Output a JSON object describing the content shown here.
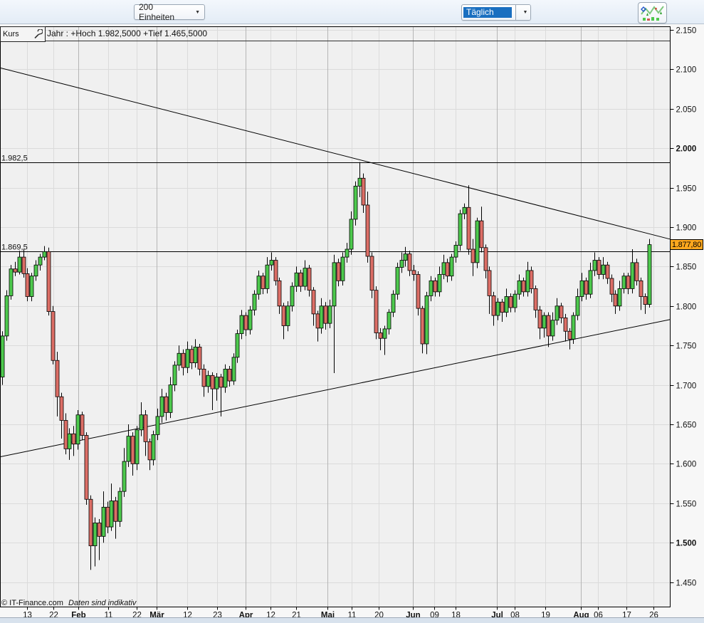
{
  "toolbar": {
    "units_label": "200 Einheiten",
    "period_value": "Täglich",
    "chart_type_icon": "candlestick-chart-icon"
  },
  "chart_header": {
    "kurs_label": "Kurs",
    "wrench_icon": "wrench-icon",
    "info_text": "Jahr : +Hoch 1.982,5000 +Tief 1.465,5000"
  },
  "price_badge": {
    "label": "1.877,80",
    "value": 1877.8,
    "color": "#ffa81e"
  },
  "footer": {
    "copyright": "© IT-Finance.com",
    "disclaimer": "Daten sind indikativ"
  },
  "colors": {
    "up": "#4dc94d",
    "down": "#dc6e66",
    "candle_border": "#000000",
    "grid": "#dbdbdb",
    "month_grid": "#b5b5b5",
    "plot_bg": "#f0f0f0",
    "axis_bg": "#f7f7f7",
    "badge": "#ffa81e",
    "period_selected_bg": "#1a6fc0"
  },
  "chart_data": {
    "type": "candlestick",
    "period": "Täglich",
    "title": "Kurs",
    "ylim": [
      1419,
      2154
    ],
    "grid": true,
    "y_ticks": [
      {
        "label": "2.150",
        "value": 2150,
        "bold": false
      },
      {
        "label": "2.100",
        "value": 2100,
        "bold": false
      },
      {
        "label": "2.050",
        "value": 2050,
        "bold": false
      },
      {
        "label": "2.000",
        "value": 2000,
        "bold": true
      },
      {
        "label": "1.950",
        "value": 1950,
        "bold": false
      },
      {
        "label": "1.900",
        "value": 1900,
        "bold": false
      },
      {
        "label": "1.850",
        "value": 1850,
        "bold": false
      },
      {
        "label": "1.800",
        "value": 1800,
        "bold": false
      },
      {
        "label": "1.750",
        "value": 1750,
        "bold": false
      },
      {
        "label": "1.700",
        "value": 1700,
        "bold": false
      },
      {
        "label": "1.650",
        "value": 1650,
        "bold": false
      },
      {
        "label": "1.600",
        "value": 1600,
        "bold": false
      },
      {
        "label": "1.550",
        "value": 1550,
        "bold": false
      },
      {
        "label": "1.500",
        "value": 1500,
        "bold": true
      },
      {
        "label": "1.450",
        "value": 1450,
        "bold": false
      }
    ],
    "x_ticks": [
      {
        "label": "13",
        "x": 38,
        "bold": false,
        "month": false
      },
      {
        "label": "22",
        "x": 75,
        "bold": false,
        "month": false
      },
      {
        "label": "Feb",
        "x": 110,
        "bold": true,
        "month": true
      },
      {
        "label": "11",
        "x": 152,
        "bold": false,
        "month": false
      },
      {
        "label": "22",
        "x": 192,
        "bold": false,
        "month": false
      },
      {
        "label": "Mär",
        "x": 220,
        "bold": true,
        "month": true
      },
      {
        "label": "12",
        "x": 263,
        "bold": false,
        "month": false
      },
      {
        "label": "23",
        "x": 305,
        "bold": false,
        "month": false
      },
      {
        "label": "Apr",
        "x": 345,
        "bold": true,
        "month": true
      },
      {
        "label": "12",
        "x": 380,
        "bold": false,
        "month": false
      },
      {
        "label": "21",
        "x": 416,
        "bold": false,
        "month": false
      },
      {
        "label": "Mai",
        "x": 460,
        "bold": true,
        "month": true
      },
      {
        "label": "11",
        "x": 494,
        "bold": false,
        "month": false
      },
      {
        "label": "20",
        "x": 532,
        "bold": false,
        "month": false
      },
      {
        "label": "Jun",
        "x": 580,
        "bold": true,
        "month": true
      },
      {
        "label": "09",
        "x": 610,
        "bold": false,
        "month": false
      },
      {
        "label": "18",
        "x": 640,
        "bold": false,
        "month": false
      },
      {
        "label": "Jul",
        "x": 698,
        "bold": true,
        "month": true
      },
      {
        "label": "08",
        "x": 723,
        "bold": false,
        "month": false
      },
      {
        "label": "19",
        "x": 766,
        "bold": false,
        "month": false
      },
      {
        "label": "Aug",
        "x": 816,
        "bold": true,
        "month": true
      },
      {
        "label": "06",
        "x": 840,
        "bold": false,
        "month": false
      },
      {
        "label": "17",
        "x": 880,
        "bold": false,
        "month": false
      },
      {
        "label": "26",
        "x": 918,
        "bold": false,
        "month": false
      }
    ],
    "horizontal_lines": [
      {
        "label": "1.982,5",
        "value": 1982.5
      },
      {
        "label": "1.869,5",
        "value": 1869.5
      }
    ],
    "trendlines": [
      {
        "name": "descending-resistance",
        "v_start": 2102,
        "v_end": 1884.7
      },
      {
        "name": "ascending-support",
        "v_start": 1608.8,
        "v_end": 1782.9
      }
    ],
    "year_high": 1982.5,
    "year_low": 1465.5,
    "last": 1877.8,
    "candles": [
      [
        1710,
        1768,
        1700,
        1762
      ],
      [
        1762,
        1820,
        1756,
        1813
      ],
      [
        1813,
        1852,
        1808,
        1847
      ],
      [
        1847,
        1856,
        1838,
        1843
      ],
      [
        1843,
        1870,
        1840,
        1862
      ],
      [
        1862,
        1872,
        1836,
        1841
      ],
      [
        1841,
        1848,
        1806,
        1812
      ],
      [
        1812,
        1842,
        1806,
        1838
      ],
      [
        1838,
        1858,
        1832,
        1852
      ],
      [
        1852,
        1866,
        1845,
        1862
      ],
      [
        1862,
        1876,
        1858,
        1869
      ],
      [
        1869,
        1874,
        1788,
        1793
      ],
      [
        1793,
        1800,
        1726,
        1731
      ],
      [
        1731,
        1742,
        1660,
        1685
      ],
      [
        1685,
        1690,
        1632,
        1655
      ],
      [
        1655,
        1664,
        1612,
        1619
      ],
      [
        1619,
        1645,
        1605,
        1638
      ],
      [
        1638,
        1648,
        1610,
        1625
      ],
      [
        1625,
        1668,
        1618,
        1662
      ],
      [
        1662,
        1666,
        1630,
        1636
      ],
      [
        1636,
        1640,
        1548,
        1555
      ],
      [
        1555,
        1560,
        1465.5,
        1496
      ],
      [
        1496,
        1532,
        1470,
        1525
      ],
      [
        1525,
        1530,
        1478,
        1508
      ],
      [
        1508,
        1565,
        1500,
        1545
      ],
      [
        1545,
        1552,
        1512,
        1520
      ],
      [
        1520,
        1575,
        1515,
        1553
      ],
      [
        1553,
        1558,
        1505,
        1527
      ],
      [
        1527,
        1570,
        1520,
        1565
      ],
      [
        1565,
        1620,
        1558,
        1603
      ],
      [
        1603,
        1650,
        1596,
        1635
      ],
      [
        1635,
        1640,
        1585,
        1600
      ],
      [
        1600,
        1648,
        1592,
        1643
      ],
      [
        1643,
        1678,
        1635,
        1662
      ],
      [
        1662,
        1668,
        1610,
        1628
      ],
      [
        1628,
        1632,
        1592,
        1605
      ],
      [
        1605,
        1642,
        1598,
        1637
      ],
      [
        1637,
        1670,
        1630,
        1660
      ],
      [
        1660,
        1695,
        1652,
        1685
      ],
      [
        1685,
        1690,
        1655,
        1665
      ],
      [
        1665,
        1710,
        1658,
        1700
      ],
      [
        1700,
        1730,
        1692,
        1725
      ],
      [
        1725,
        1750,
        1718,
        1740
      ],
      [
        1740,
        1745,
        1712,
        1722
      ],
      [
        1722,
        1755,
        1715,
        1745
      ],
      [
        1745,
        1750,
        1720,
        1728
      ],
      [
        1728,
        1758,
        1722,
        1748
      ],
      [
        1748,
        1752,
        1712,
        1720
      ],
      [
        1720,
        1726,
        1685,
        1698
      ],
      [
        1698,
        1718,
        1690,
        1712
      ],
      [
        1712,
        1716,
        1668,
        1695
      ],
      [
        1695,
        1715,
        1680,
        1710
      ],
      [
        1710,
        1714,
        1660,
        1697
      ],
      [
        1697,
        1726,
        1690,
        1720
      ],
      [
        1720,
        1724,
        1698,
        1705
      ],
      [
        1705,
        1740,
        1700,
        1735
      ],
      [
        1735,
        1770,
        1728,
        1765
      ],
      [
        1765,
        1795,
        1758,
        1788
      ],
      [
        1788,
        1792,
        1762,
        1770
      ],
      [
        1770,
        1800,
        1764,
        1795
      ],
      [
        1795,
        1820,
        1788,
        1815
      ],
      [
        1815,
        1845,
        1808,
        1838
      ],
      [
        1838,
        1842,
        1815,
        1822
      ],
      [
        1822,
        1862,
        1816,
        1852
      ],
      [
        1852,
        1868,
        1845,
        1858
      ],
      [
        1858,
        1862,
        1826,
        1832
      ],
      [
        1832,
        1836,
        1790,
        1800
      ],
      [
        1800,
        1804,
        1758,
        1775
      ],
      [
        1775,
        1806,
        1768,
        1800
      ],
      [
        1800,
        1830,
        1793,
        1825
      ],
      [
        1825,
        1850,
        1818,
        1842
      ],
      [
        1842,
        1846,
        1818,
        1825
      ],
      [
        1825,
        1858,
        1820,
        1848
      ],
      [
        1848,
        1852,
        1812,
        1820
      ],
      [
        1820,
        1824,
        1775,
        1790
      ],
      [
        1790,
        1794,
        1755,
        1772
      ],
      [
        1772,
        1810,
        1765,
        1800
      ],
      [
        1800,
        1805,
        1770,
        1778
      ],
      [
        1778,
        1808,
        1772,
        1800
      ],
      [
        1800,
        1865,
        1715,
        1855
      ],
      [
        1855,
        1860,
        1825,
        1832
      ],
      [
        1832,
        1868,
        1826,
        1862
      ],
      [
        1862,
        1880,
        1855,
        1872
      ],
      [
        1872,
        1920,
        1865,
        1910
      ],
      [
        1910,
        1958,
        1902,
        1952
      ],
      [
        1952,
        1982.5,
        1938,
        1962
      ],
      [
        1962,
        1968,
        1918,
        1928
      ],
      [
        1928,
        1945,
        1855,
        1863
      ],
      [
        1863,
        1868,
        1810,
        1820
      ],
      [
        1820,
        1825,
        1758,
        1766
      ],
      [
        1766,
        1772,
        1744,
        1759
      ],
      [
        1759,
        1775,
        1738,
        1771
      ],
      [
        1771,
        1796,
        1764,
        1792
      ],
      [
        1792,
        1820,
        1786,
        1815
      ],
      [
        1815,
        1855,
        1808,
        1849
      ],
      [
        1849,
        1868,
        1842,
        1858
      ],
      [
        1858,
        1875,
        1850,
        1866
      ],
      [
        1866,
        1870,
        1838,
        1845
      ],
      [
        1845,
        1852,
        1832,
        1840
      ],
      [
        1840,
        1844,
        1788,
        1797
      ],
      [
        1797,
        1800,
        1740,
        1752
      ],
      [
        1752,
        1818,
        1739,
        1813
      ],
      [
        1813,
        1838,
        1806,
        1832
      ],
      [
        1832,
        1836,
        1812,
        1818
      ],
      [
        1818,
        1850,
        1812,
        1840
      ],
      [
        1840,
        1865,
        1834,
        1855
      ],
      [
        1855,
        1860,
        1830,
        1838
      ],
      [
        1838,
        1866,
        1832,
        1862
      ],
      [
        1862,
        1882,
        1855,
        1877
      ],
      [
        1877,
        1922,
        1870,
        1917
      ],
      [
        1917,
        1930,
        1910,
        1925
      ],
      [
        1925,
        1953,
        1865,
        1872
      ],
      [
        1872,
        1885,
        1838,
        1855
      ],
      [
        1855,
        1912,
        1848,
        1908
      ],
      [
        1908,
        1926,
        1868,
        1874
      ],
      [
        1874,
        1878,
        1835,
        1845
      ],
      [
        1845,
        1850,
        1790,
        1813
      ],
      [
        1813,
        1818,
        1775,
        1788
      ],
      [
        1788,
        1810,
        1782,
        1805
      ],
      [
        1805,
        1809,
        1780,
        1792
      ],
      [
        1792,
        1822,
        1786,
        1812
      ],
      [
        1812,
        1816,
        1792,
        1798
      ],
      [
        1798,
        1820,
        1792,
        1815
      ],
      [
        1815,
        1840,
        1808,
        1832
      ],
      [
        1832,
        1836,
        1812,
        1818
      ],
      [
        1818,
        1856,
        1812,
        1845
      ],
      [
        1845,
        1850,
        1816,
        1822
      ],
      [
        1822,
        1826,
        1785,
        1795
      ],
      [
        1795,
        1800,
        1758,
        1772
      ],
      [
        1772,
        1792,
        1760,
        1788
      ],
      [
        1788,
        1792,
        1748,
        1762
      ],
      [
        1762,
        1792,
        1756,
        1782
      ],
      [
        1782,
        1810,
        1776,
        1800
      ],
      [
        1800,
        1804,
        1778,
        1785
      ],
      [
        1785,
        1790,
        1755,
        1768
      ],
      [
        1768,
        1772,
        1745,
        1758
      ],
      [
        1758,
        1792,
        1752,
        1788
      ],
      [
        1788,
        1822,
        1782,
        1812
      ],
      [
        1812,
        1842,
        1806,
        1832
      ],
      [
        1832,
        1836,
        1808,
        1815
      ],
      [
        1815,
        1855,
        1810,
        1845
      ],
      [
        1845,
        1868,
        1838,
        1858
      ],
      [
        1858,
        1862,
        1834,
        1840
      ],
      [
        1840,
        1862,
        1834,
        1852
      ],
      [
        1852,
        1856,
        1828,
        1835
      ],
      [
        1835,
        1840,
        1805,
        1815
      ],
      [
        1815,
        1820,
        1790,
        1800
      ],
      [
        1800,
        1832,
        1794,
        1822
      ],
      [
        1822,
        1842,
        1816,
        1838
      ],
      [
        1838,
        1842,
        1815,
        1822
      ],
      [
        1822,
        1872,
        1816,
        1855
      ],
      [
        1855,
        1860,
        1826,
        1832
      ],
      [
        1832,
        1836,
        1795,
        1812
      ],
      [
        1812,
        1816,
        1790,
        1802
      ],
      [
        1802,
        1885,
        1798,
        1877.8
      ]
    ]
  }
}
